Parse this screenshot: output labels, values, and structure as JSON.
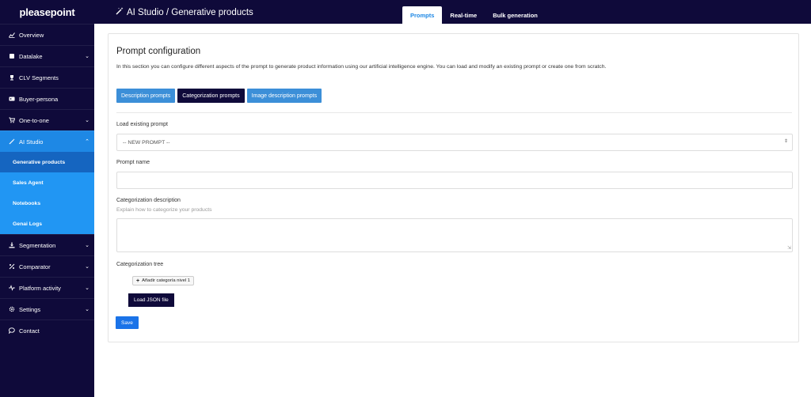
{
  "brand": {
    "logo": "pleasepoint"
  },
  "header": {
    "title": "AI Studio / Generative products",
    "title_icon": "magic-wand-icon"
  },
  "tabs": [
    {
      "label": "Prompts",
      "active": true
    },
    {
      "label": "Real-time",
      "active": false
    },
    {
      "label": "Bulk generation",
      "active": false
    }
  ],
  "sidebar": {
    "items": [
      {
        "label": "Overview",
        "icon": "chart-line-icon"
      },
      {
        "label": "Datalake",
        "icon": "database-icon"
      },
      {
        "label": "CLV Segments",
        "icon": "trophy-icon"
      },
      {
        "label": "Buyer-persona",
        "icon": "id-card-icon"
      },
      {
        "label": "One-to-one",
        "icon": "cart-icon"
      },
      {
        "label": "AI Studio",
        "icon": "magic-wand-icon"
      }
    ],
    "sub_items": [
      {
        "label": "Generative products",
        "active": true
      },
      {
        "label": "Sales Agent"
      },
      {
        "label": "Notebooks"
      },
      {
        "label": "Genai Logs"
      }
    ],
    "items_after": [
      {
        "label": "Segmentation",
        "icon": "download-icon"
      },
      {
        "label": "Comparator",
        "icon": "percent-icon"
      },
      {
        "label": "Platform activity",
        "icon": "pulse-icon"
      },
      {
        "label": "Settings",
        "icon": "gear-icon"
      },
      {
        "label": "Contact",
        "icon": "chat-icon"
      }
    ]
  },
  "main": {
    "title": "Prompt configuration",
    "description": "In this section you can configure different aspects of the prompt to generate product information using our artificial intelligence engine. You can load and modify an existing prompt or create one from scratch.",
    "prompt_types": [
      "Description prompts",
      "Categorization prompts",
      "Image description prompts"
    ],
    "load_label": "Load existing prompt",
    "load_value": "-- NEW PROMPT --",
    "name_label": "Prompt name",
    "name_value": "",
    "cat_desc_label": "Categorization description",
    "cat_desc_help": "Explain how to categorize your products",
    "cat_desc_value": "",
    "tree_label": "Categorization tree",
    "add_category_label": "Añadir categoría nivel 1",
    "load_json_label": "Load JSON file",
    "save_label": "Save"
  },
  "colors": {
    "nav_bg": "#0f0a3a",
    "accent_blue": "#1e88e5",
    "active_submenu": "#1565c0",
    "prompt_button_blue": "#3c8fd8"
  }
}
